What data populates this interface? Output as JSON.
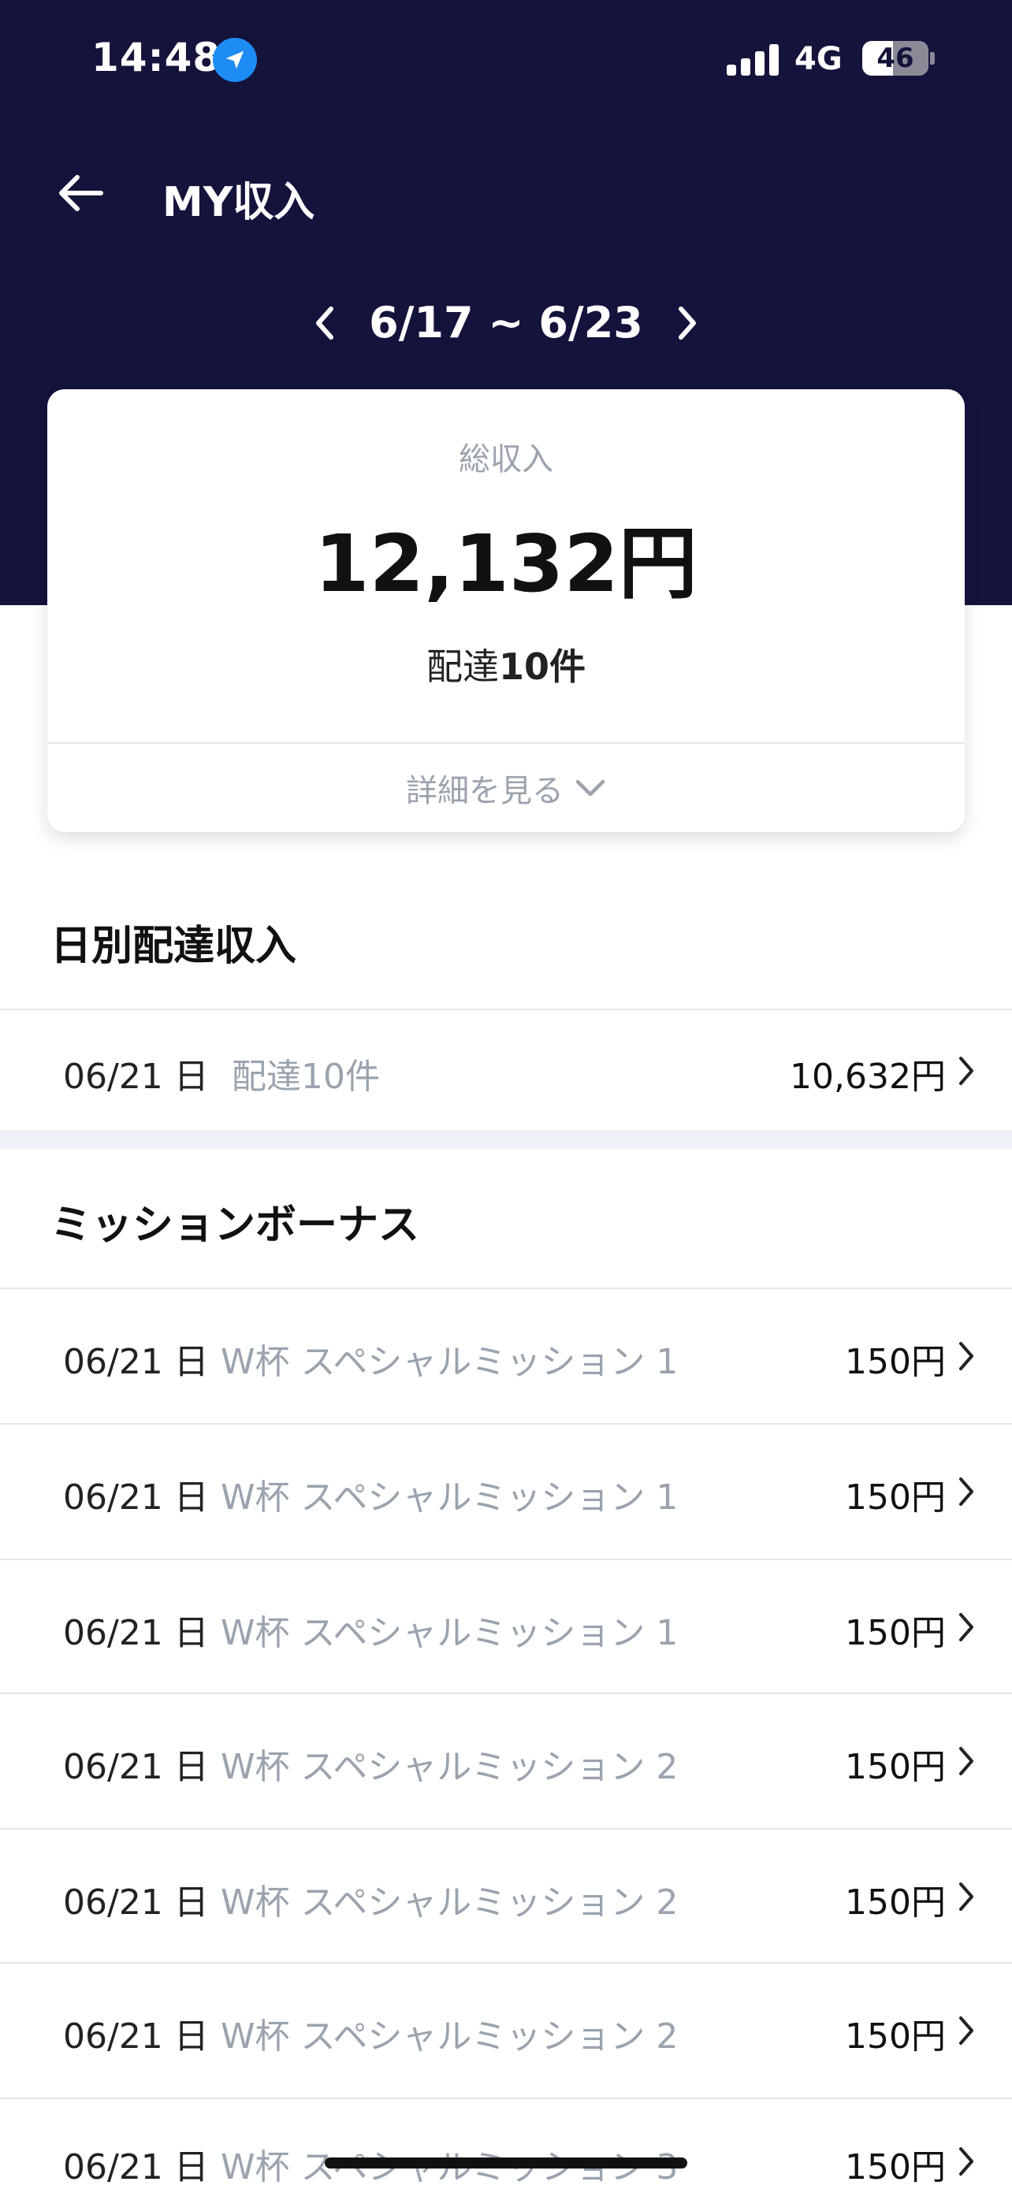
{
  "status_bar": {
    "time": "14:48",
    "network": "4G",
    "battery": "46",
    "battery_level": 0.46,
    "location_icon": "location-arrow-icon",
    "signal_icon": "cellular-signal-icon"
  },
  "header": {
    "title": "MY収入",
    "back_icon": "arrow-left-icon",
    "date_range": "6/17 ~ 6/23",
    "prev_icon": "chevron-left-icon",
    "next_icon": "chevron-right-icon",
    "background_color": "#14133b"
  },
  "summary": {
    "total_label": "総収入",
    "total_amount": "12,132円",
    "delivery_prefix": "配達",
    "delivery_count": "10件",
    "detail_link": "詳細を見る",
    "detail_icon": "chevron-down-icon"
  },
  "daily_section": {
    "title": "日別配達収入",
    "rows": [
      {
        "date": "06/21 日",
        "desc": "配達10件",
        "amount": "10,632円"
      }
    ]
  },
  "mission_section": {
    "title": "ミッションボーナス",
    "rows": [
      {
        "date": "06/21 日",
        "desc": "W杯 スペシャルミッション 1",
        "amount": "150円"
      },
      {
        "date": "06/21 日",
        "desc": "W杯 スペシャルミッション 1",
        "amount": "150円"
      },
      {
        "date": "06/21 日",
        "desc": "W杯 スペシャルミッション 1",
        "amount": "150円"
      },
      {
        "date": "06/21 日",
        "desc": "W杯 スペシャルミッション 2",
        "amount": "150円"
      },
      {
        "date": "06/21 日",
        "desc": "W杯 スペシャルミッション 2",
        "amount": "150円"
      },
      {
        "date": "06/21 日",
        "desc": "W杯 スペシャルミッション 2",
        "amount": "150円"
      },
      {
        "date": "06/21 日",
        "desc": "W杯 スペシャルミッション 3",
        "amount": "150円"
      }
    ]
  }
}
